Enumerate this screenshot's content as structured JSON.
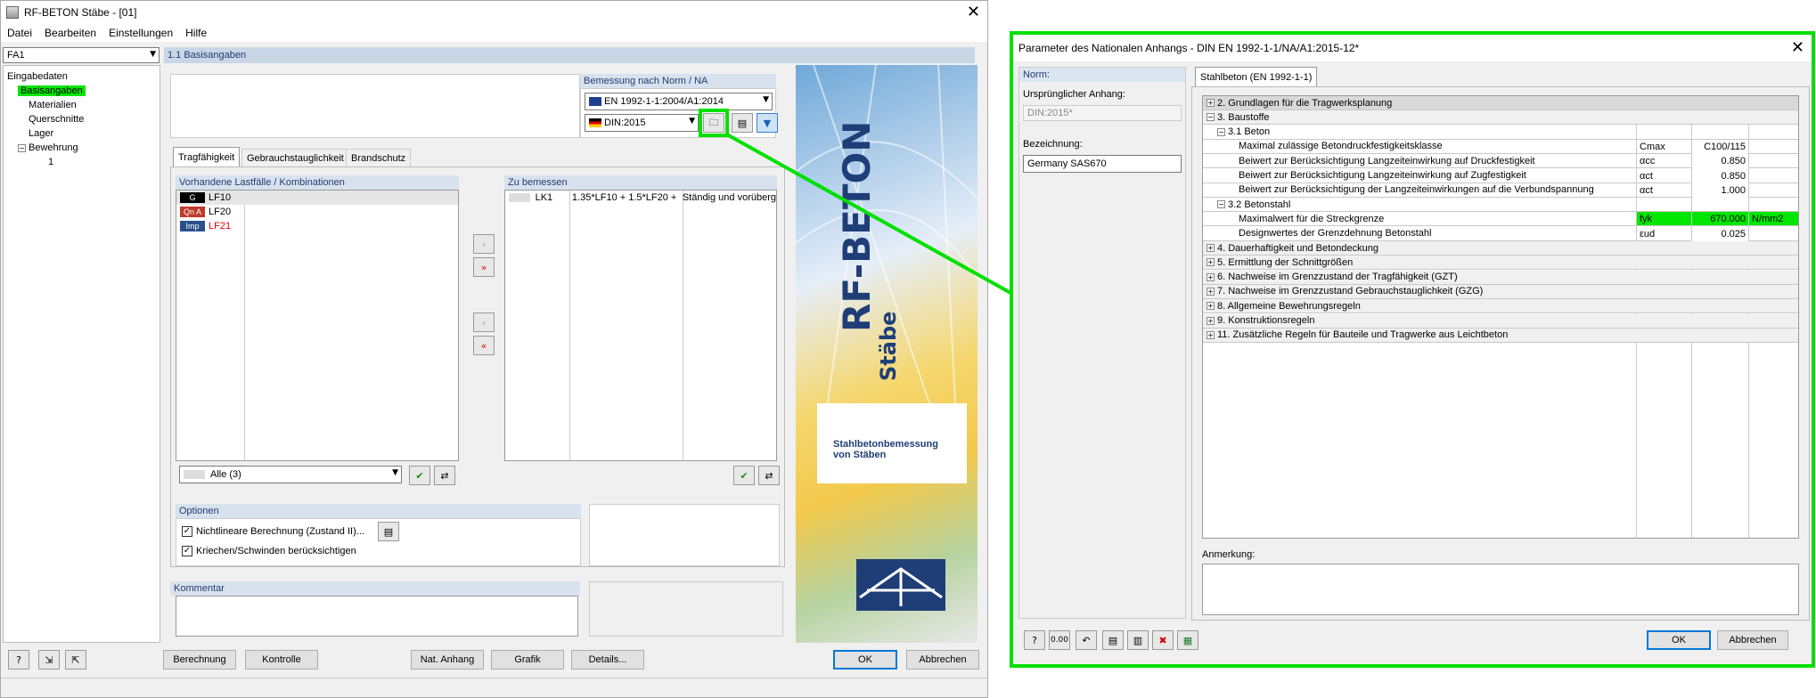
{
  "main": {
    "title": "RF-BETON Stäbe - [01]",
    "menu": [
      "Datei",
      "Bearbeiten",
      "Einstellungen",
      "Hilfe"
    ],
    "case_select": "FA1",
    "section_title": "1.1 Basisangaben",
    "tree": {
      "root": "Eingabedaten",
      "items": [
        "Basisangaben",
        "Materialien",
        "Querschnitte",
        "Lager",
        "Bewehrung",
        "1"
      ]
    },
    "norm": {
      "label": "Bemessung nach Norm / NA",
      "standard": "EN 1992-1-1:2004/A1:2014",
      "annex": "DIN:2015"
    },
    "tabs": [
      "Tragfähigkeit",
      "Gebrauchstauglichkeit",
      "Brandschutz"
    ],
    "existing": {
      "label": "Vorhandene Lastfälle / Kombinationen",
      "rows": [
        {
          "tag": "G",
          "tag_color": "#000000",
          "name": "LF10"
        },
        {
          "tag": "Qn A",
          "tag_color": "#c0392b",
          "name": "LF20"
        },
        {
          "tag": "Imp",
          "tag_color": "#2c4f8c",
          "name": "LF21"
        }
      ],
      "filter": "Alle (3)"
    },
    "design": {
      "label": "Zu bemessen",
      "rows": [
        {
          "id": "LK1",
          "formula": "1.35*LF10 + 1.5*LF20 +",
          "type": "Ständig und vorüberg"
        }
      ]
    },
    "options": {
      "label": "Optionen",
      "items": [
        "Nichtlineare Berechnung (Zustand II)...",
        "Kriechen/Schwinden berücksichtigen"
      ]
    },
    "comment_label": "Kommentar",
    "banner": {
      "title": "RF-BETON",
      "sub": "Stäbe",
      "desc1": "Stahlbetonbemessung",
      "desc2": "von Stäben"
    },
    "buttons": [
      "Berechnung",
      "Kontrolle",
      "Nat. Anhang",
      "Grafik",
      "Details...",
      "OK",
      "Abbrechen"
    ]
  },
  "dialog": {
    "title": "Parameter des Nationalen Anhangs - DIN EN 1992-1-1/NA/A1:2015-12*",
    "norm_label": "Norm:",
    "orig_label": "Ursprünglicher Anhang:",
    "orig_value": "DIN:2015*",
    "name_label": "Bezeichnung:",
    "name_value": "Germany SAS670",
    "tab": "Stahlbeton (EN 1992-1-1)",
    "rows": [
      {
        "t": "2. Grundlagen für die Tragwerksplanung",
        "lvl": 0,
        "pm": "+"
      },
      {
        "t": "3. Baustoffe",
        "lvl": 0,
        "pm": "-"
      },
      {
        "t": "3.1 Beton",
        "lvl": 1,
        "pm": "-"
      },
      {
        "t": "Maximal zulässige Betondruckfestigkeitsklasse",
        "lvl": 2,
        "sym": "Cmax",
        "val": "C100/115",
        "unit": ""
      },
      {
        "t": "Beiwert zur Berücksichtigung Langzeiteinwirkung auf Druckfestigkeit",
        "lvl": 2,
        "sym": "αcc",
        "val": "0.850",
        "unit": ""
      },
      {
        "t": "Beiwert zur Berücksichtigung Langzeiteinwirkung auf Zugfestigkeit",
        "lvl": 2,
        "sym": "αct",
        "val": "0.850",
        "unit": ""
      },
      {
        "t": "Beiwert zur Berücksichtigung der Langzeiteinwirkungen auf die Verbundspannung",
        "lvl": 2,
        "sym": "αct",
        "val": "1.000",
        "unit": ""
      },
      {
        "t": "3.2 Betonstahl",
        "lvl": 1,
        "pm": "-"
      },
      {
        "t": "Maximalwert für die Streckgrenze",
        "lvl": 2,
        "sym": "fyk",
        "val": "670.000",
        "unit": "N/mm2",
        "hl": true
      },
      {
        "t": "Designwertes der Grenzdehnung Betonstahl",
        "lvl": 2,
        "sym": "εud",
        "val": "0.025",
        "unit": ""
      },
      {
        "t": "4. Dauerhaftigkeit und Betondeckung",
        "lvl": 0,
        "pm": "+"
      },
      {
        "t": "5. Ermittlung der Schnittgrößen",
        "lvl": 0,
        "pm": "+"
      },
      {
        "t": "6. Nachweise im Grenzzustand der Tragfähigkeit (GZT)",
        "lvl": 0,
        "pm": "+"
      },
      {
        "t": "7. Nachweise im Grenzzustand Gebrauchstauglichkeit (GZG)",
        "lvl": 0,
        "pm": "+"
      },
      {
        "t": "8. Allgemeine Bewehrungsregeln",
        "lvl": 0,
        "pm": "+"
      },
      {
        "t": "9. Konstruktionsregeln",
        "lvl": 0,
        "pm": "+"
      },
      {
        "t": "11. Zusätzliche Regeln für Bauteile und Tragwerke aus Leichtbeton",
        "lvl": 0,
        "pm": "+"
      }
    ],
    "remark_label": "Anmerkung:",
    "ok": "OK",
    "cancel": "Abbrechen"
  }
}
